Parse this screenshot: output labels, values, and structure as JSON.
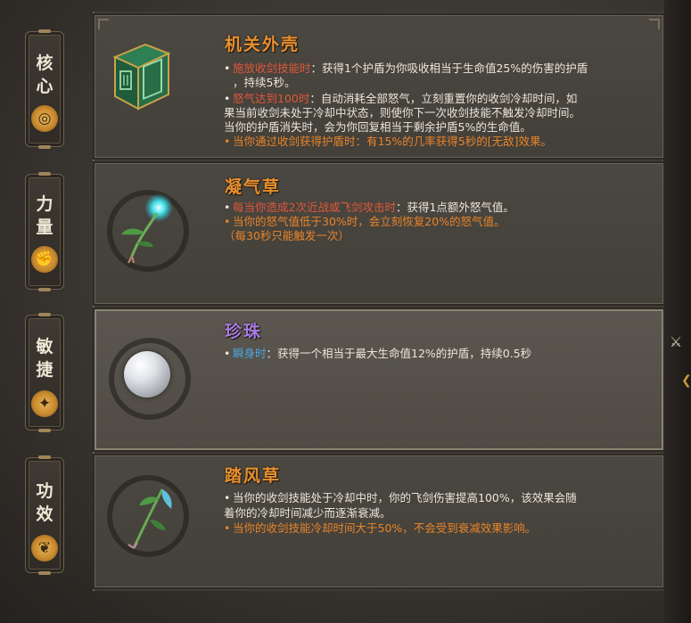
{
  "tabs": [
    {
      "chars": [
        "核",
        "心"
      ],
      "icon": "swirl-icon",
      "glyph": "◎"
    },
    {
      "chars": [
        "力",
        "量"
      ],
      "icon": "fist-icon",
      "glyph": "✊"
    },
    {
      "chars": [
        "敏",
        "捷"
      ],
      "icon": "leaping-figure-icon",
      "glyph": "✦"
    },
    {
      "chars": [
        "功",
        "效"
      ],
      "icon": "leaf-icon",
      "glyph": "❦"
    }
  ],
  "cards": [
    {
      "title": "机关外壳",
      "item_icon": "jade-cube-icon",
      "lines": [
        {
          "bullet": "•",
          "hl": "施放收剑技能时",
          "text": "：获得1个护盾为你吸收相当于生命值25%的伤害的护盾"
        },
        {
          "bullet": "",
          "hl": "",
          "text": "，持续5秒。"
        },
        {
          "bullet": "•",
          "hl": "怒气达到100时",
          "text": "：自动消耗全部怒气，立刻重置你的收剑冷却时间，如"
        },
        {
          "bullet": "",
          "hl": "",
          "text": "果当前收剑未处于冷却中状态，则使你下一次收剑技能不触发冷却时间。"
        },
        {
          "bullet": "",
          "hl": "",
          "text": "当你的护盾消失时，会为你回复相当于剩余护盾5%的生命值。"
        },
        {
          "bullet": "•",
          "hl": "",
          "text": "当你通过收剑获得护盾时：有15%的几率获得5秒的[无敌]效果。",
          "orange": true
        }
      ]
    },
    {
      "title": "凝气草",
      "item_icon": "glowing-herb-icon",
      "lines": [
        {
          "bullet": "•",
          "hl": "每当你造成2次近战或飞剑攻击时",
          "text": "：获得1点额外怒气值。"
        },
        {
          "bullet": "•",
          "hl": "",
          "text": "当你的怒气值低于30%时，会立刻恢复20%的怒气值。",
          "orange": true
        },
        {
          "bullet": "",
          "hl": "",
          "text": "（每30秒只能触发一次）",
          "orange": true
        }
      ]
    },
    {
      "title": "珍珠",
      "item_icon": "pearl-icon",
      "lines": [
        {
          "bullet": "•",
          "hlb": "瞬身时",
          "text": "：获得一个相当于最大生命值12%的护盾，持续0.5秒"
        }
      ]
    },
    {
      "title": "踏风草",
      "item_icon": "wind-herb-icon",
      "lines": [
        {
          "bullet": "•",
          "hl": "",
          "text": "当你的收剑技能处于冷却中时，你的飞剑伤害提高100%，该效果会随"
        },
        {
          "bullet": "",
          "hl": "",
          "text": "着你的冷却时间减少而逐渐衰减。"
        },
        {
          "bullet": "•",
          "hl": "",
          "text": "当你的收剑技能冷却时间大于50%，不会受到衰减效果影响。",
          "orange": true
        }
      ]
    }
  ],
  "right_widget": {
    "icon": "crossed-swords-icon",
    "glyph": "⚔"
  },
  "right_arrow": {
    "icon": "chevron-left-icon",
    "glyph": "❮"
  }
}
